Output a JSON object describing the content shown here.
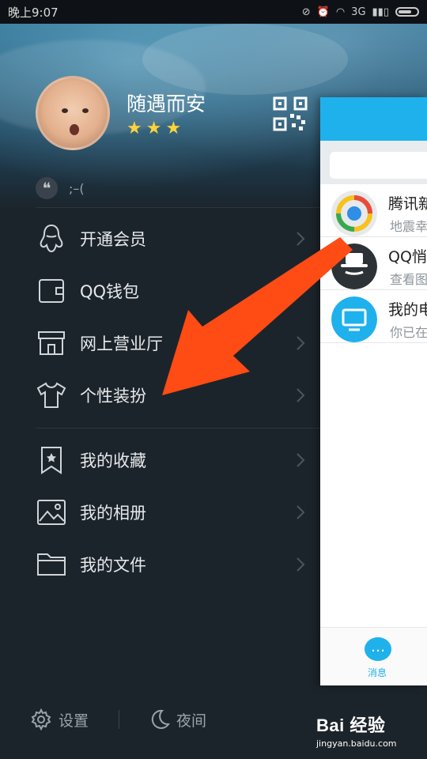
{
  "status_bar": {
    "time": "晚上9:07",
    "network": "3G"
  },
  "profile": {
    "name": "随遇而安",
    "stars": 3,
    "signature": ";–("
  },
  "menu": {
    "items": [
      {
        "label": "开通会员",
        "icon": "penguin-icon"
      },
      {
        "label": "QQ钱包",
        "icon": "wallet-icon"
      },
      {
        "label": "网上营业厅",
        "icon": "store-icon"
      },
      {
        "label": "个性装扮",
        "icon": "tshirt-icon"
      },
      {
        "label": "我的收藏",
        "icon": "bookmark-star-icon"
      },
      {
        "label": "我的相册",
        "icon": "photo-icon"
      },
      {
        "label": "我的文件",
        "icon": "folder-icon"
      }
    ]
  },
  "bottom": {
    "settings": "设置",
    "night": "夜间"
  },
  "chat_panel": {
    "chats": [
      {
        "name": "腾讯新",
        "sub": "地震幸"
      },
      {
        "name": "QQ悄",
        "sub": "查看图"
      },
      {
        "name": "我的电",
        "sub": "你已在"
      }
    ],
    "tab_label": "消息"
  },
  "watermark": {
    "logo": "Bai 经验",
    "url": "jingyan.baidu.com"
  },
  "colors": {
    "accent": "#1fb1ec",
    "arrow": "#ff4b14",
    "star": "#ffd23a"
  }
}
